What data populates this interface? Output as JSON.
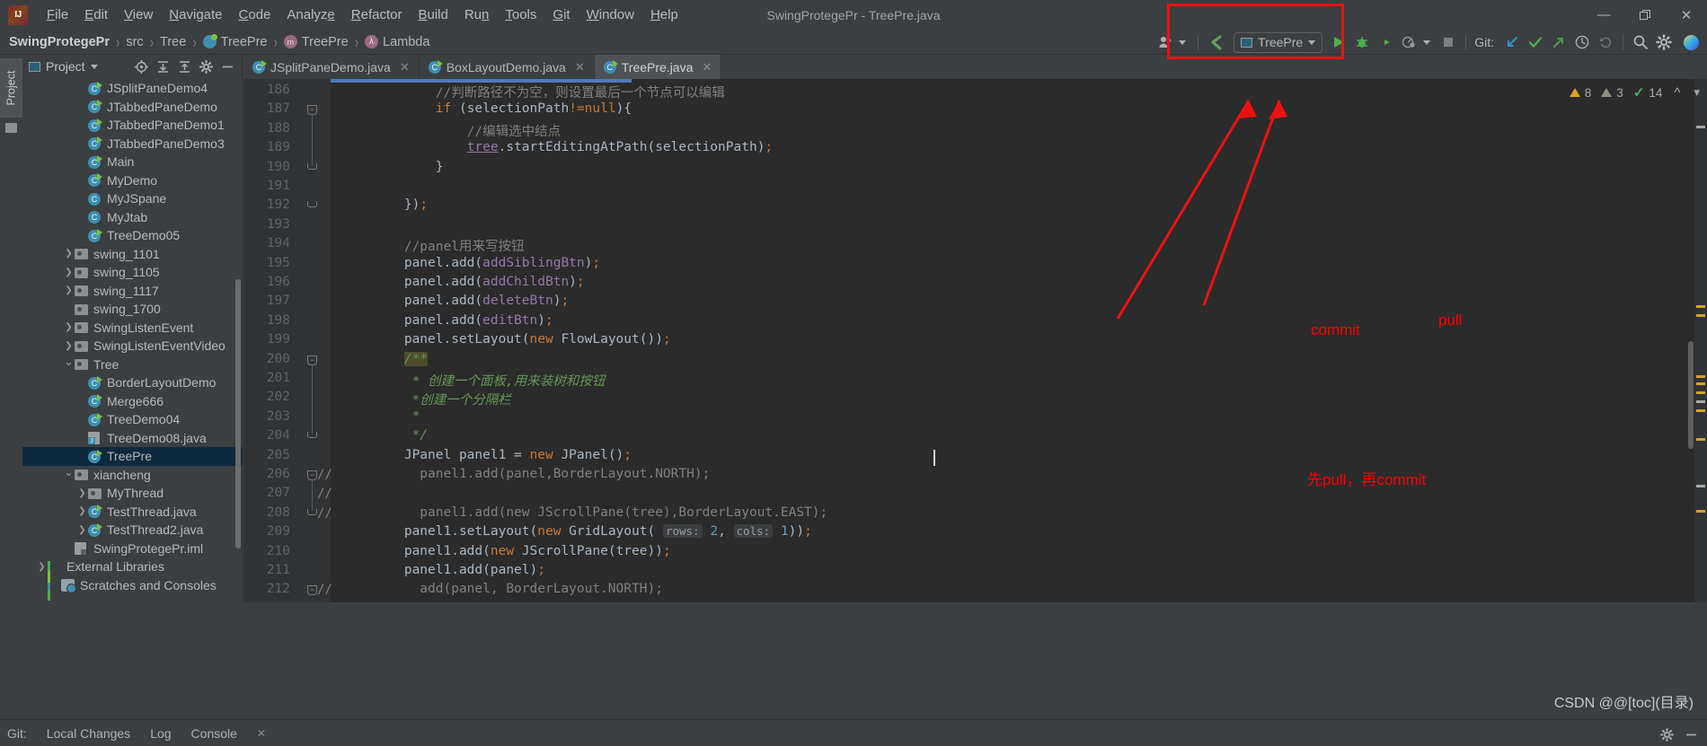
{
  "window": {
    "title": "SwingProtegePr - TreePre.java",
    "controls": {
      "minimize": "—",
      "restore": "❐",
      "close": "✕"
    }
  },
  "menubar": {
    "logo": "intellij-logo",
    "items": [
      "File",
      "Edit",
      "View",
      "Navigate",
      "Code",
      "Analyze",
      "Refactor",
      "Build",
      "Run",
      "Tools",
      "Git",
      "Window",
      "Help"
    ]
  },
  "breadcrumb": {
    "items": [
      {
        "label": "SwingProtegePr",
        "icon": "none",
        "bold": true
      },
      {
        "label": "src",
        "icon": "none",
        "bold": false
      },
      {
        "label": "Tree",
        "icon": "none",
        "bold": false
      },
      {
        "label": "TreePre",
        "icon": "class-icon",
        "bold": false
      },
      {
        "label": "TreePre",
        "icon": "method-icon",
        "bold": false
      },
      {
        "label": "Lambda",
        "icon": "lambda-icon",
        "bold": false
      }
    ]
  },
  "toolbar": {
    "avatar_icon": "user-group-icon",
    "back_icon": "back-arrow-icon",
    "run_config": "TreePre",
    "run_icon": "run-icon",
    "debug_icon": "debug-icon",
    "coverage_icon": "run-with-coverage-icon",
    "profile_icon": "profiler-icon",
    "stop_icon": "stop-icon",
    "git_label": "Git:",
    "git_update_icon": "update-project-icon",
    "git_commit_icon": "commit-icon",
    "git_push_icon": "push-icon",
    "git_history_icon": "history-icon",
    "git_rollback_icon": "rollback-icon",
    "search_icon": "search-icon",
    "settings_icon": "gear-icon"
  },
  "project_panel": {
    "tool_tab_label": "Project",
    "title": "Project",
    "icons": [
      "locate-icon",
      "expand-all-icon",
      "collapse-all-icon",
      "gear-icon",
      "hide-icon"
    ],
    "tree": [
      {
        "label": "JSplitPaneDemo4",
        "icon": "class-run-icon",
        "indent": 4,
        "arrow": ""
      },
      {
        "label": "JTabbedPaneDemo",
        "icon": "class-run-icon",
        "indent": 4,
        "arrow": ""
      },
      {
        "label": "JTabbedPaneDemo1",
        "icon": "class-run-icon",
        "indent": 4,
        "arrow": ""
      },
      {
        "label": "JTabbedPaneDemo3",
        "icon": "class-run-icon",
        "indent": 4,
        "arrow": ""
      },
      {
        "label": "Main",
        "icon": "class-run-icon",
        "indent": 4,
        "arrow": ""
      },
      {
        "label": "MyDemo",
        "icon": "class-run-icon",
        "indent": 4,
        "arrow": ""
      },
      {
        "label": "MyJSpane",
        "icon": "class-icon",
        "indent": 4,
        "arrow": ""
      },
      {
        "label": "MyJtab",
        "icon": "class-icon",
        "indent": 4,
        "arrow": ""
      },
      {
        "label": "TreeDemo05",
        "icon": "class-run-icon",
        "indent": 4,
        "arrow": ""
      },
      {
        "label": "swing_1101",
        "icon": "folder-icon",
        "indent": 3,
        "arrow": "›"
      },
      {
        "label": "swing_1105",
        "icon": "folder-icon",
        "indent": 3,
        "arrow": "›"
      },
      {
        "label": "swing_1117",
        "icon": "folder-icon",
        "indent": 3,
        "arrow": "›"
      },
      {
        "label": "swing_1700",
        "icon": "folder-icon",
        "indent": 3,
        "arrow": ""
      },
      {
        "label": "SwingListenEvent",
        "icon": "folder-icon",
        "indent": 3,
        "arrow": "›"
      },
      {
        "label": "SwingListenEventVideo",
        "icon": "folder-icon",
        "indent": 3,
        "arrow": "›"
      },
      {
        "label": "Tree",
        "icon": "folder-icon",
        "indent": 3,
        "arrow": "⌄"
      },
      {
        "label": "BorderLayoutDemo",
        "icon": "class-run-icon",
        "indent": 4,
        "arrow": ""
      },
      {
        "label": "Merge666",
        "icon": "class-run-icon",
        "indent": 4,
        "arrow": ""
      },
      {
        "label": "TreeDemo04",
        "icon": "class-run-icon",
        "indent": 4,
        "arrow": ""
      },
      {
        "label": "TreeDemo08.java",
        "icon": "java-file-icon",
        "indent": 4,
        "arrow": ""
      },
      {
        "label": "TreePre",
        "icon": "class-run-icon",
        "indent": 4,
        "arrow": "",
        "selected": true
      },
      {
        "label": "xiancheng",
        "icon": "folder-icon",
        "indent": 3,
        "arrow": "⌄"
      },
      {
        "label": "MyThread",
        "icon": "folder-icon",
        "indent": 4,
        "arrow": "›"
      },
      {
        "label": "TestThread.java",
        "icon": "class-run-icon",
        "indent": 4,
        "arrow": "›"
      },
      {
        "label": "TestThread2.java",
        "icon": "class-run-icon",
        "indent": 4,
        "arrow": "›"
      },
      {
        "label": "SwingProtegePr.iml",
        "icon": "iml-file-icon",
        "indent": 3,
        "arrow": ""
      },
      {
        "label": "External Libraries",
        "icon": "library-icon",
        "indent": 1,
        "arrow": "›"
      },
      {
        "label": "Scratches and Consoles",
        "icon": "scratch-icon",
        "indent": 2,
        "arrow": ""
      }
    ]
  },
  "editor": {
    "tabs": [
      {
        "label": "JSplitPaneDemo.java",
        "active": false,
        "close": "✕"
      },
      {
        "label": "BoxLayoutDemo.java",
        "active": false,
        "close": "✕"
      },
      {
        "label": "TreePre.java",
        "active": true,
        "close": "✕"
      }
    ],
    "first_line_number": 186,
    "lines": [
      {
        "n": 186,
        "fold": "",
        "comment_glyph": "",
        "tokens": [
          {
            "t": "            ",
            "c": ""
          },
          {
            "t": "//判断路径不为空，则设置最后一个节点可以编辑",
            "c": "cm"
          }
        ]
      },
      {
        "n": 187,
        "fold": "minus-box",
        "comment_glyph": "",
        "tokens": [
          {
            "t": "            ",
            "c": ""
          },
          {
            "t": "if",
            "c": "k"
          },
          {
            "t": " (selectionPath",
            "c": ""
          },
          {
            "t": "!=",
            "c": "k"
          },
          {
            "t": "null",
            "c": "k"
          },
          {
            "t": "){",
            "c": ""
          }
        ]
      },
      {
        "n": 188,
        "fold": "",
        "comment_glyph": "",
        "tokens": [
          {
            "t": "                ",
            "c": ""
          },
          {
            "t": "//编辑选中结点",
            "c": "cm"
          }
        ]
      },
      {
        "n": 189,
        "fold": "",
        "comment_glyph": "",
        "tokens": [
          {
            "t": "                ",
            "c": ""
          },
          {
            "t": "tree",
            "c": "fld ul"
          },
          {
            "t": ".startEditingAtPath(selectionPath)",
            "c": ""
          },
          {
            "t": ";",
            "c": "semi"
          }
        ]
      },
      {
        "n": 190,
        "fold": "end-brace",
        "comment_glyph": "",
        "tokens": [
          {
            "t": "            }",
            "c": ""
          }
        ]
      },
      {
        "n": 191,
        "fold": "",
        "comment_glyph": "",
        "tokens": []
      },
      {
        "n": 192,
        "fold": "end-brace",
        "comment_glyph": "",
        "tokens": [
          {
            "t": "        })",
            "c": ""
          },
          {
            "t": ";",
            "c": "semi"
          }
        ]
      },
      {
        "n": 193,
        "fold": "",
        "comment_glyph": "",
        "tokens": []
      },
      {
        "n": 194,
        "fold": "",
        "comment_glyph": "",
        "tokens": [
          {
            "t": "        ",
            "c": ""
          },
          {
            "t": "//panel用来写按钮",
            "c": "cm"
          }
        ]
      },
      {
        "n": 195,
        "fold": "",
        "comment_glyph": "",
        "tokens": [
          {
            "t": "        panel.add(",
            "c": ""
          },
          {
            "t": "addSiblingBtn",
            "c": "fld"
          },
          {
            "t": ")",
            "c": ""
          },
          {
            "t": ";",
            "c": "semi"
          }
        ]
      },
      {
        "n": 196,
        "fold": "",
        "comment_glyph": "",
        "tokens": [
          {
            "t": "        panel.add(",
            "c": ""
          },
          {
            "t": "addChildBtn",
            "c": "fld"
          },
          {
            "t": ")",
            "c": ""
          },
          {
            "t": ";",
            "c": "semi"
          }
        ]
      },
      {
        "n": 197,
        "fold": "",
        "comment_glyph": "",
        "tokens": [
          {
            "t": "        panel.add(",
            "c": ""
          },
          {
            "t": "deleteBtn",
            "c": "fld"
          },
          {
            "t": ")",
            "c": ""
          },
          {
            "t": ";",
            "c": "semi"
          }
        ]
      },
      {
        "n": 198,
        "fold": "",
        "comment_glyph": "",
        "tokens": [
          {
            "t": "        panel.add(",
            "c": ""
          },
          {
            "t": "editBtn",
            "c": "fld"
          },
          {
            "t": ")",
            "c": ""
          },
          {
            "t": ";",
            "c": "semi"
          }
        ]
      },
      {
        "n": 199,
        "fold": "",
        "comment_glyph": "",
        "tokens": [
          {
            "t": "        panel.setLayout(",
            "c": ""
          },
          {
            "t": "new",
            "c": "k"
          },
          {
            "t": " FlowLayout())",
            "c": ""
          },
          {
            "t": ";",
            "c": "semi"
          }
        ]
      },
      {
        "n": 200,
        "fold": "minus-box",
        "comment_glyph": "",
        "tokens": [
          {
            "t": "        ",
            "c": ""
          },
          {
            "t": "/**",
            "c": "doc hl-fold"
          }
        ]
      },
      {
        "n": 201,
        "fold": "",
        "comment_glyph": "",
        "tokens": [
          {
            "t": "         * 创建一个面板,用来装树和按钮",
            "c": "doc"
          }
        ]
      },
      {
        "n": 202,
        "fold": "",
        "comment_glyph": "",
        "tokens": [
          {
            "t": "         *创建一个分隔栏",
            "c": "doc"
          }
        ]
      },
      {
        "n": 203,
        "fold": "",
        "comment_glyph": "",
        "tokens": [
          {
            "t": "         *",
            "c": "doc"
          }
        ]
      },
      {
        "n": 204,
        "fold": "end-brace",
        "comment_glyph": "",
        "tokens": [
          {
            "t": "         */",
            "c": "doc"
          }
        ]
      },
      {
        "n": 205,
        "fold": "",
        "comment_glyph": "",
        "tokens": [
          {
            "t": "        JPanel panel1 = ",
            "c": ""
          },
          {
            "t": "new",
            "c": "k"
          },
          {
            "t": " JPanel()",
            "c": ""
          },
          {
            "t": ";",
            "c": "semi"
          }
        ]
      },
      {
        "n": 206,
        "fold": "minus-box",
        "comment_glyph": "//",
        "tokens": [
          {
            "t": "          panel1.add(panel,BorderLayout.NORTH);",
            "c": "cm"
          }
        ]
      },
      {
        "n": 207,
        "fold": "",
        "comment_glyph": "//",
        "tokens": []
      },
      {
        "n": 208,
        "fold": "end-brace",
        "comment_glyph": "//",
        "tokens": [
          {
            "t": "          panel1.add(new JScrollPane(tree),BorderLayout.EAST);",
            "c": "cm"
          }
        ]
      },
      {
        "n": 209,
        "fold": "",
        "comment_glyph": "",
        "tokens": [
          {
            "t": "        panel1.setLayout(",
            "c": ""
          },
          {
            "t": "new",
            "c": "k"
          },
          {
            "t": " GridLayout( ",
            "c": ""
          },
          {
            "t": "rows:",
            "c": "hint"
          },
          {
            "t": " ",
            "c": ""
          },
          {
            "t": "2",
            "c": "num"
          },
          {
            "t": ", ",
            "c": ""
          },
          {
            "t": "cols:",
            "c": "hint"
          },
          {
            "t": " ",
            "c": ""
          },
          {
            "t": "1",
            "c": "num"
          },
          {
            "t": "))",
            "c": ""
          },
          {
            "t": ";",
            "c": "semi"
          }
        ]
      },
      {
        "n": 210,
        "fold": "",
        "comment_glyph": "",
        "tokens": [
          {
            "t": "        panel1.add(",
            "c": ""
          },
          {
            "t": "new",
            "c": "k"
          },
          {
            "t": " JScrollPane(tree))",
            "c": ""
          },
          {
            "t": ";",
            "c": "semi"
          }
        ]
      },
      {
        "n": 211,
        "fold": "",
        "comment_glyph": "",
        "tokens": [
          {
            "t": "        panel1.add(panel)",
            "c": ""
          },
          {
            "t": ";",
            "c": "semi"
          }
        ]
      },
      {
        "n": 212,
        "fold": "minus-box",
        "comment_glyph": "//",
        "tokens": [
          {
            "t": "          add(panel, BorderLayout.NORTH);",
            "c": "cm"
          }
        ]
      }
    ]
  },
  "inspections": {
    "warning_count": "8",
    "weak_warning_count": "3",
    "ok_count": "14",
    "prev_icon": "chevron-up-icon",
    "next_icon": "chevron-down-icon"
  },
  "annotations": [
    {
      "id": "commit-label",
      "text": "commit"
    },
    {
      "id": "pull-label",
      "text": "pull"
    },
    {
      "id": "order-note",
      "text": "先pull，再commit"
    }
  ],
  "bottombar": {
    "items": [
      "Git:",
      "Local Changes",
      "Log",
      "Console"
    ],
    "close_icon": "✕"
  },
  "watermark": "CSDN @@[toc](目录)",
  "colors": {
    "accent_blue": "#3d8fb0",
    "run_green": "#4caf50",
    "annotation_red": "#ff0000",
    "editor_bg": "#2b2b2b",
    "panel_bg": "#3c3f41",
    "selection_bg": "#0d293e",
    "warning_yellow": "#d9a520"
  }
}
